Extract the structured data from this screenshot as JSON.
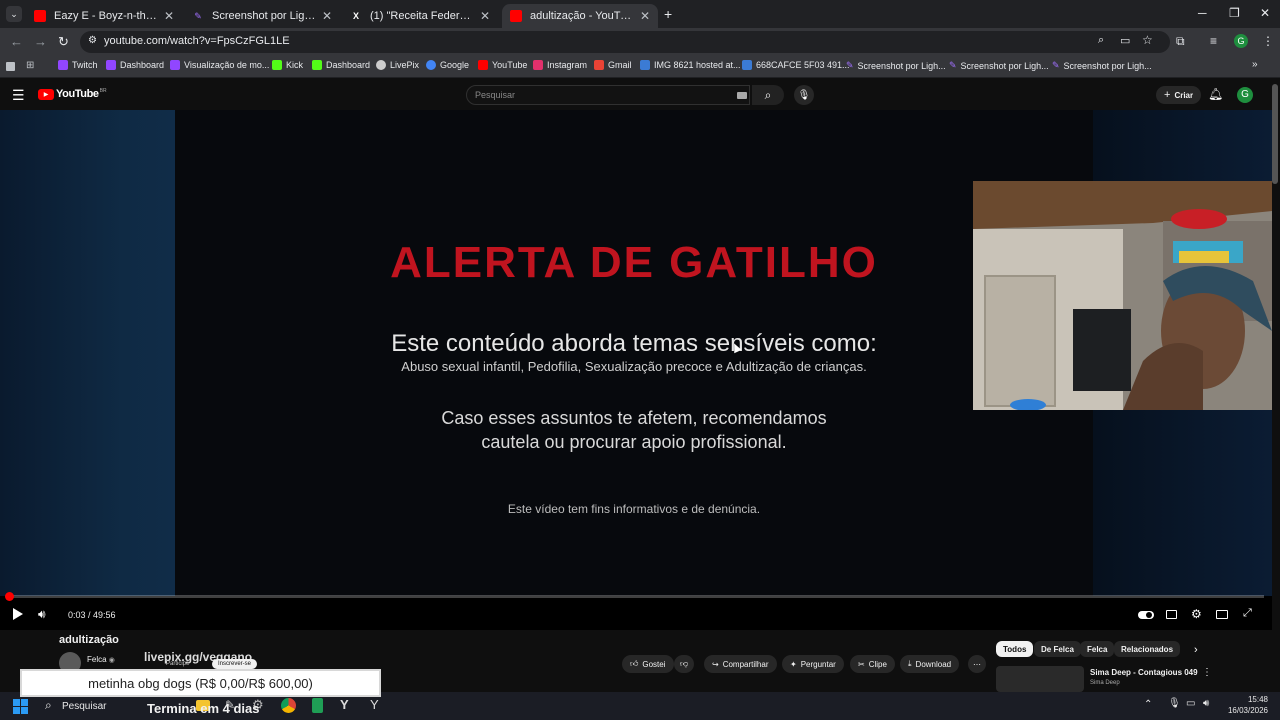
{
  "browser": {
    "tabs": [
      {
        "title": "Eazy E - Boyz-n-the-Hood (Mu",
        "favicon_color": "#ff0000"
      },
      {
        "title": "Screenshot por Lightshot",
        "favicon_color": "#a070ff"
      },
      {
        "title": "(1) \"Receita Federal\" - Search /",
        "favicon_color": "#ffffff"
      },
      {
        "title": "adultização - YouTube",
        "favicon_color": "#ff0000"
      }
    ],
    "url": "youtube.com/watch?v=FpsCzFGL1LE",
    "bookmarks": [
      {
        "label": "Twitch",
        "color": "#9146ff"
      },
      {
        "label": "Dashboard",
        "color": "#9146ff"
      },
      {
        "label": "Visualização de mo...",
        "color": "#9146ff"
      },
      {
        "label": "Kick",
        "color": "#53fc18"
      },
      {
        "label": "Dashboard",
        "color": "#53fc18"
      },
      {
        "label": "LivePix",
        "color": "#cccccc"
      },
      {
        "label": "Google",
        "color": "#4285f4"
      },
      {
        "label": "YouTube",
        "color": "#ff0000"
      },
      {
        "label": "Instagram",
        "color": "#e1306c"
      },
      {
        "label": "Gmail",
        "color": "#ea4335"
      },
      {
        "label": "IMG 8621 hosted at...",
        "color": "#3b7bd4"
      },
      {
        "label": "668CAFCE 5F03 491...",
        "color": "#3b7bd4"
      },
      {
        "label": "Screenshot por Ligh...",
        "color": "#a070ff"
      },
      {
        "label": "Screenshot por Ligh...",
        "color": "#a070ff"
      },
      {
        "label": "Screenshot por Ligh...",
        "color": "#a070ff"
      }
    ]
  },
  "youtube": {
    "logo_text": "YouTube",
    "logo_badge": "BR",
    "search_placeholder": "Pesquisar",
    "create_label": "Criar",
    "avatar_letter": "G"
  },
  "video": {
    "alert_title": "ALERTA DE GATILHO",
    "line1": "Este conteúdo aborda temas sensíveis como:",
    "line2": "Abuso sexual infantil, Pedofilia, Sexualização precoce e Adultização de crianças.",
    "line3": "Caso esses assuntos te afetem, recomendamos",
    "line4": "cautela ou procurar apoio profissional.",
    "line5": "Este vídeo tem fins informativos e de denúncia.",
    "time_display": "0:03 / 49:56",
    "progress_fraction": 0.001,
    "title": "adultização",
    "channel": "Felca",
    "overlay_livepix": "livepix.gg/veggano",
    "overlay_subscribe": "Inscrever-se",
    "overlay_participe": "Participe"
  },
  "actions": {
    "like": "Gostei",
    "share": "Compartilhar",
    "ask": "Perguntar",
    "clip": "Clipe",
    "download": "Download"
  },
  "chips": [
    "Todos",
    "De Felca",
    "Felca",
    "Relacionados"
  ],
  "recommendation": {
    "title": "Sima Deep - Contagious 049",
    "channel": "Sima Deep"
  },
  "donation_text": "metinha obg dogs (R$ 0,00/R$ 600,00)",
  "taskbar": {
    "search_label": "Pesquisar",
    "overlay_text": "Termina em 4 dias",
    "time": "15:48",
    "date": "16/03/2026"
  }
}
